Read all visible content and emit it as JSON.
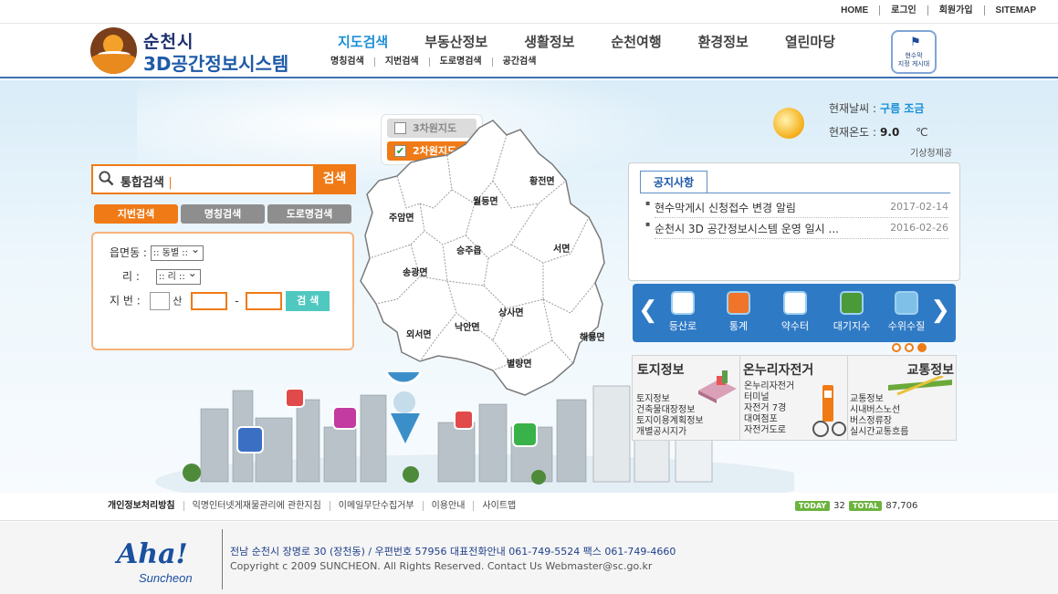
{
  "top_links": [
    "HOME",
    "로그인",
    "회원가입",
    "SITEMAP"
  ],
  "logo": {
    "line1": "순천시",
    "line2": "3D공간정보시스템"
  },
  "main_nav": [
    "지도검색",
    "부동산정보",
    "생활정보",
    "순천여행",
    "환경정보",
    "열린마당"
  ],
  "sub_nav": [
    "명칭검색",
    "지번검색",
    "도로명검색",
    "공간검색"
  ],
  "board_badge": {
    "line1": "현수막",
    "line2": "지정 게시대"
  },
  "weather": {
    "label_weather": "현재날씨 :",
    "weather_value": "구름 조금",
    "label_temp": "현재온도 :",
    "temp_value": "9.0",
    "temp_unit": "℃",
    "source": "기상청제공"
  },
  "map_toggle": {
    "option_3d": "3차원지도",
    "option_2d": "2차원지도",
    "selected": "2차원지도"
  },
  "search": {
    "placeholder": "통합검색",
    "button": "검색"
  },
  "search_tabs": [
    "지번검색",
    "명칭검색",
    "도로명검색"
  ],
  "jibun_form": {
    "label_dong": "읍면동 :",
    "dong_value": ":: 동별 ::",
    "label_ri": "리 :",
    "ri_value": ":: 리 ::",
    "label_jibun": "지 번 :",
    "san": "산",
    "dash": "-",
    "submit": "검 색"
  },
  "map_regions": [
    "황전면",
    "월등면",
    "주암면",
    "서면",
    "승주읍",
    "송광면",
    "상사면",
    "낙안면",
    "외서면",
    "해룡면",
    "별량면"
  ],
  "notice": {
    "tab": "공지사항",
    "items": [
      {
        "title": "현수막게시 신청접수 변경 알림",
        "date": "2017-02-14"
      },
      {
        "title": "순천시 3D 공간정보시스템 운영 일시 ...",
        "date": "2016-02-26"
      }
    ]
  },
  "quick_menu": [
    "등산로",
    "통계",
    "약수터",
    "대기지수",
    "수위수질"
  ],
  "quick_arrows": {
    "prev": "❮",
    "next": "❯"
  },
  "info_boxes": [
    {
      "title": "토지정보",
      "items": [
        "토지정보",
        "건축물대장정보",
        "토지이용계획정보",
        "개별공시지가"
      ]
    },
    {
      "title": "온누리자전거",
      "items": [
        "온누리자전거",
        "터미널",
        "자전거 7경",
        "대여점포",
        "자전거도로"
      ]
    },
    {
      "title": "교통정보",
      "items": [
        "교통정보",
        "시내버스노선",
        "버스정류장",
        "실시간교통흐름"
      ]
    }
  ],
  "footer_links": [
    "개인정보처리방침",
    "익명인터넷게재물관리에 관한지침",
    "이메일무단수집거부",
    "이용안내",
    "사이트맵"
  ],
  "counter": {
    "today_label": "TODAY",
    "today": "32",
    "total_label": "TOTAL",
    "total": "87,706"
  },
  "footer": {
    "address": "전남 순천시 장명로 30 (장천동) / 우편번호 57956 대표전화안내 061-749-5524 팩스 061-749-4660",
    "copyright": "Copyright c 2009 SUNCHEON. All Rights Reserved. Contact Us Webmaster@sc.go.kr",
    "logo_main": "Aha!",
    "logo_sub": "Suncheon"
  },
  "colors": {
    "accent": "#f07a15",
    "nav_active": "#1e8fd6",
    "brand_blue": "#1e5aa8",
    "quick_bg": "#2f7ac5"
  }
}
